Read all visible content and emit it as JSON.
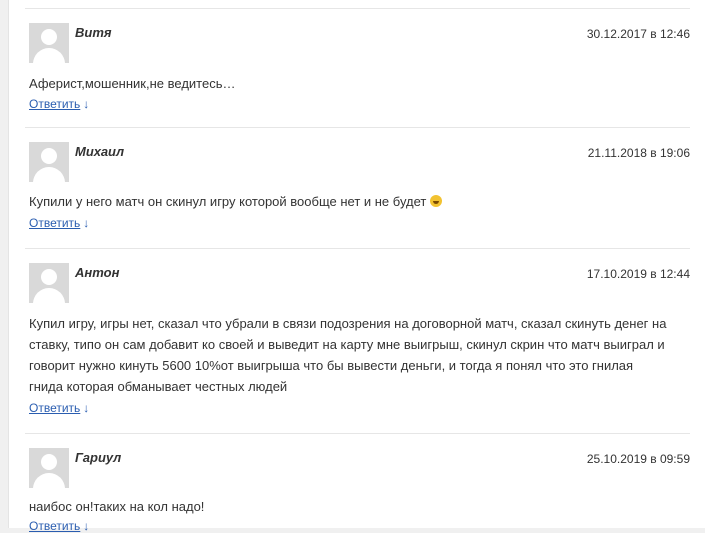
{
  "comments": [
    {
      "author": "Витя",
      "date": "30.12.2017 в 12:46",
      "text": "Аферист,мошенник,не ведитесь…",
      "reply_label": "Ответить",
      "reply_arrow": "↓"
    },
    {
      "author": "Михаил",
      "date": "21.11.2018 в 19:06",
      "text": "Купили у него матч он скинул игру которой вообще нет и не будет",
      "reply_label": "Ответить",
      "reply_arrow": "↓",
      "emoji_icon": "laughing-face-icon"
    },
    {
      "author": "Антон",
      "date": "17.10.2019 в 12:44",
      "text": "Купил игру, игры нет, сказал что убрали в связи подозрения на договорной матч, сказал скинуть денег на ставку, типо он сам добавит ко своей и выведит на карту мне выигрыш, скинул скрин что матч выиграл и говорит нужно кинуть 5600 10%от выигрыша что бы вывести деньги, и тогда я понял что это гнилая гнида которая обманывает честных людей",
      "reply_label": "Ответить",
      "reply_arrow": "↓"
    },
    {
      "author": "Гариул",
      "date": "25.10.2019 в 09:59",
      "text": "наибос он!таких на кол надо!",
      "reply_label": "Ответить",
      "reply_arrow": "↓"
    }
  ]
}
